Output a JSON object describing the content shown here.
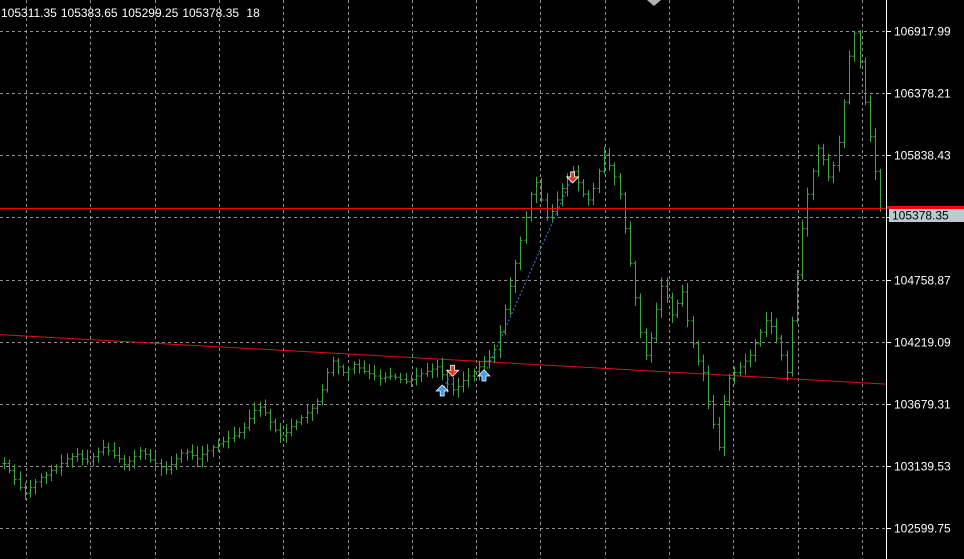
{
  "header": {
    "open": "105311.35",
    "high": "105383.65",
    "low": "105299.25",
    "close": "105378.35",
    "volume": "18"
  },
  "colors": {
    "background": "#000000",
    "grid": "#c0c0c0",
    "candles": "#3fa63f",
    "bid_line": "#ff0000",
    "trend_line": "#e01010",
    "axis": "#ffffff",
    "price_tag": "#c0c8d0",
    "buy_arrow": "#3aa0e8",
    "sell_arrow": "#e04020",
    "trade_line": "#3a7fd8"
  },
  "chart_data": {
    "type": "line",
    "title": "",
    "ylim": [
      102329.86,
      107187.88
    ],
    "y_ticks": [
      "106917.99",
      "106378.21",
      "105838.43",
      "105298.65",
      "104758.87",
      "104219.09",
      "103679.31",
      "103139.53",
      "102599.75"
    ],
    "y_tick_values": [
      106917.99,
      106378.21,
      105838.43,
      105298.65,
      104758.87,
      104219.09,
      103679.31,
      103139.53,
      102599.75
    ],
    "current_price": "105378.35",
    "current_price_value": 105378.35,
    "bar_count": 163,
    "series": [
      {
        "values": [
          103160,
          103100,
          103020,
          102950,
          102900,
          102950,
          103000,
          103040,
          103060,
          103100,
          103130,
          103160,
          103200,
          103220,
          103240,
          103200,
          103180,
          103220,
          103260,
          103300,
          103270,
          103230,
          103200,
          103150,
          103180,
          103220,
          103270,
          103240,
          103190,
          103160,
          103130,
          103110,
          103150,
          103200,
          103250,
          103260,
          103230,
          103200,
          103240,
          103270,
          103300,
          103330,
          103350,
          103380,
          103400,
          103430,
          103470,
          103550,
          103620,
          103650,
          103600,
          103520,
          103450,
          103400,
          103430,
          103480,
          103520,
          103560,
          103600,
          103640,
          103700,
          103800,
          103950,
          104050,
          104000,
          103950,
          103980,
          104020,
          103990,
          103960,
          103940,
          103920,
          103900,
          103910,
          103920,
          103910,
          103890,
          103870,
          103890,
          103920,
          103940,
          103960,
          103980,
          104000,
          103930,
          103850,
          103800,
          103830,
          103880,
          103920,
          103960,
          104000,
          104050,
          104080,
          104150,
          104300,
          104500,
          104700,
          104900,
          105100,
          105300,
          105500,
          105600,
          105450,
          105300,
          105350,
          105450,
          105550,
          105650,
          105700,
          105600,
          105500,
          105450,
          105550,
          105700,
          105850,
          105750,
          105650,
          105500,
          105200,
          104900,
          104600,
          104300,
          104100,
          104250,
          104500,
          104700,
          104600,
          104450,
          104550,
          104650,
          104400,
          104200,
          104050,
          103950,
          103700,
          103500,
          103300,
          103700,
          103900,
          103950,
          104000,
          104050,
          104100,
          104200,
          104300,
          104400,
          104350,
          104250,
          104100,
          103950,
          104400,
          104800,
          105200,
          105500,
          105700,
          105900,
          105800,
          105650,
          105750,
          105950,
          106300,
          106700,
          106900,
          106650,
          106300,
          106000,
          105700,
          105378.35
        ]
      }
    ],
    "trend_line": {
      "start": 104280,
      "end": 103850
    },
    "trade_markers": [
      {
        "type": "buy",
        "bar": 84,
        "price": 103790
      },
      {
        "type": "sell",
        "bar": 86,
        "price": 103970
      },
      {
        "type": "buy",
        "bar": 92,
        "price": 103920
      },
      {
        "type": "sell",
        "bar": 109,
        "price": 105650
      }
    ]
  }
}
